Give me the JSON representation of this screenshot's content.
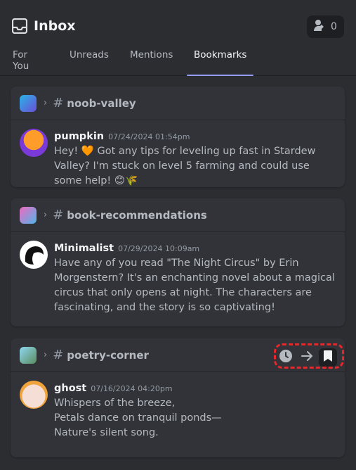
{
  "header": {
    "title": "Inbox",
    "inbox_icon": "inbox-tray-icon",
    "help_count": "0",
    "help_icon": "person-help-icon"
  },
  "tabs": [
    {
      "label": "For You",
      "active": false
    },
    {
      "label": "Unreads",
      "active": false
    },
    {
      "label": "Mentions",
      "active": false
    },
    {
      "label": "Bookmarks",
      "active": true
    }
  ],
  "colors": {
    "background": "#2b2d31",
    "card": "#313338",
    "accent": "#949cf7",
    "highlight": "#e8262b"
  },
  "bookmarks": [
    {
      "channel": "noob-valley",
      "author": "pumpkin",
      "timestamp": "07/24/2024 01:54pm",
      "text": "Hey! 🧡 Got any tips for leveling up fast in Stardew Valley? I'm stuck on level 5 farming and could use some help! 😊🌾"
    },
    {
      "channel": "book-recommendations",
      "author": "Minimalist",
      "timestamp": "07/29/2024 10:09am",
      "text": "Have any of you read \"The Night Circus\" by Erin Morgenstern? It's an enchanting novel about a magical circus that only opens at night. The characters are fascinating, and the story is so captivating!"
    },
    {
      "channel": "poetry-corner",
      "author": "ghost",
      "timestamp": "07/16/2024 04:20pm",
      "text": "Whispers of the breeze,\nPetals dance on tranquil ponds—\nNature's silent song.",
      "actions": [
        "clock-icon",
        "arrow-right-icon",
        "bookmark-icon"
      ]
    }
  ]
}
